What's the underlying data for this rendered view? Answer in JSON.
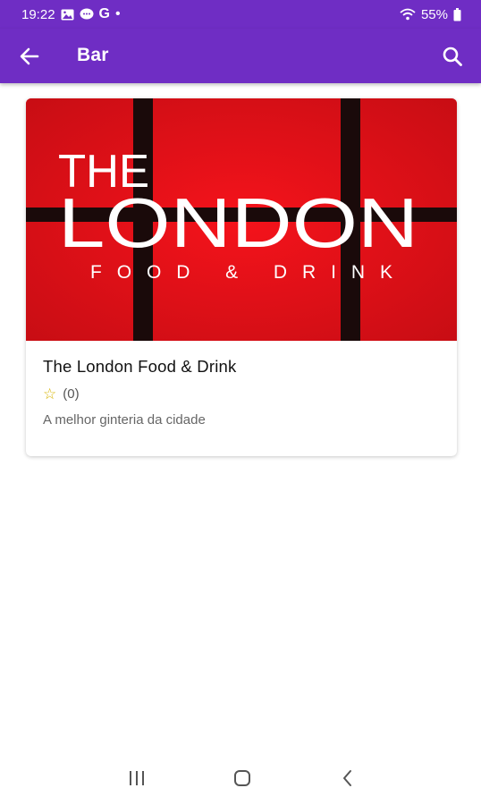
{
  "status_bar": {
    "time": "19:22",
    "google_letter": "G",
    "dot": "•",
    "battery": "55%"
  },
  "app_bar": {
    "title": "Bar"
  },
  "card": {
    "image_logo": {
      "line1": "THE",
      "line2": "LONDON",
      "line3": "FOOD & DRINK"
    },
    "title": "The London Food & Drink",
    "star": "☆",
    "rating_count": "(0)",
    "description": "A melhor ginteria da cidade"
  },
  "colors": {
    "primary": "#6f2dc4",
    "logo_red": "#e0121a",
    "star": "#d6b300"
  }
}
